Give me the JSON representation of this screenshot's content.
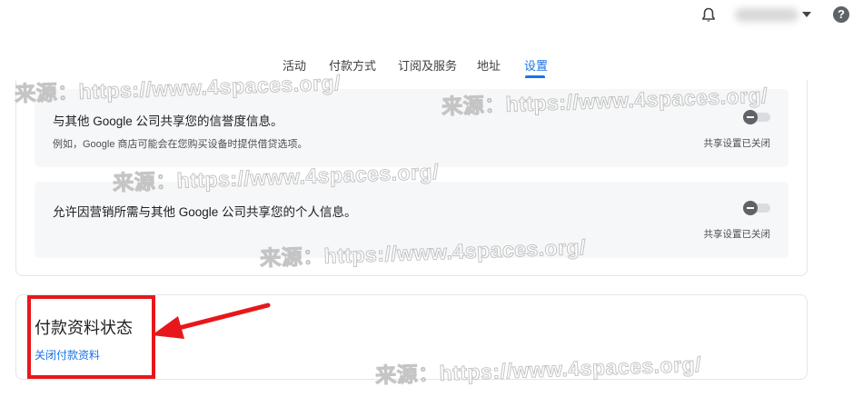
{
  "header": {
    "bell_icon": "bell-icon",
    "account_caret_icon": "caret-down-icon",
    "help_icon": "help-icon",
    "help_glyph": "?"
  },
  "tabs": [
    {
      "label": "活动",
      "active": false
    },
    {
      "label": "付款方式",
      "active": false
    },
    {
      "label": "订阅及服务",
      "active": false
    },
    {
      "label": "地址",
      "active": false
    },
    {
      "label": "设置",
      "active": true
    }
  ],
  "settings": [
    {
      "title": "与其他 Google 公司共享您的信誉度信息。",
      "description": "例如，Google 商店可能会在您购买设备时提供借贷选项。",
      "status": "共享设置已关闭",
      "enabled": false
    },
    {
      "title": "允许因营销所需与其他 Google 公司共享您的个人信息。",
      "status": "共享设置已关闭",
      "enabled": false
    }
  ],
  "payment_status": {
    "title": "付款资料状态",
    "link_label": "关闭付款资料"
  },
  "watermark": "来源：https://www.4spaces.org/",
  "colors": {
    "accent": "#1a73e8",
    "annotation_red": "#e8171b",
    "block_bg": "#f6f7f8"
  }
}
